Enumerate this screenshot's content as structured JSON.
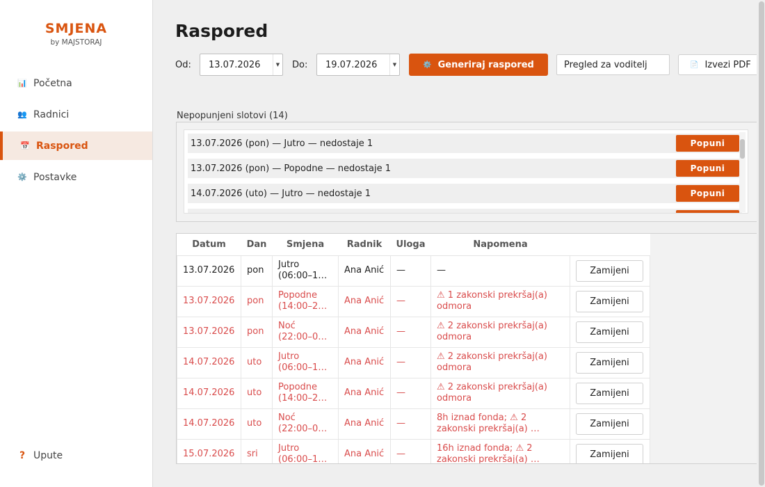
{
  "brand": {
    "name": "SMJENA",
    "sub": "by MAJSTORAJ"
  },
  "sidebar": {
    "items": [
      {
        "icon": "📊",
        "label": "Početna"
      },
      {
        "icon": "👥",
        "label": "Radnici"
      },
      {
        "icon": "📅",
        "label": "Raspored"
      },
      {
        "icon": "⚙️",
        "label": "Postavke"
      }
    ],
    "help": {
      "icon": "?",
      "label": "Upute"
    }
  },
  "page": {
    "title": "Raspored"
  },
  "toolbar": {
    "from_label": "Od:",
    "from_value": "13.07.2026",
    "to_label": "Do:",
    "to_value": "19.07.2026",
    "generate_label": "Generiraj raspored",
    "generate_icon": "⚙️",
    "view_label": "Pregled za voditelj",
    "pdf_label": "Izvezi PDF",
    "pdf_icon": "📄"
  },
  "unfilled": {
    "title": "Nepopunjeni slotovi (14)",
    "fill_label": "Popuni",
    "slots": [
      "13.07.2026 (pon) — Jutro — nedostaje 1",
      "13.07.2026 (pon) — Popodne — nedostaje 1",
      "14.07.2026 (uto) — Jutro — nedostaje 1",
      ""
    ]
  },
  "table": {
    "headers": [
      "Datum",
      "Dan",
      "Smjena",
      "Radnik",
      "Uloga",
      "Napomena",
      ""
    ],
    "swap_label": "Zamijeni",
    "rows": [
      {
        "datum": "13.07.2026",
        "dan": "pon",
        "smjena1": "Jutro",
        "smjena2": "(06:00–1…",
        "radnik": "Ana Anić",
        "uloga": "—",
        "nap1": "—",
        "nap2": ""
      },
      {
        "datum": "13.07.2026",
        "dan": "pon",
        "smjena1": "Popodne",
        "smjena2": "(14:00–2…",
        "radnik": "Ana Anić",
        "uloga": "—",
        "nap1": "⚠ 1 zakonski prekršaj(a)",
        "nap2": "odmora"
      },
      {
        "datum": "13.07.2026",
        "dan": "pon",
        "smjena1": "Noć",
        "smjena2": "(22:00–0…",
        "radnik": "Ana Anić",
        "uloga": "—",
        "nap1": "⚠ 2 zakonski prekršaj(a)",
        "nap2": "odmora"
      },
      {
        "datum": "14.07.2026",
        "dan": "uto",
        "smjena1": "Jutro",
        "smjena2": "(06:00–1…",
        "radnik": "Ana Anić",
        "uloga": "—",
        "nap1": "⚠ 2 zakonski prekršaj(a)",
        "nap2": "odmora"
      },
      {
        "datum": "14.07.2026",
        "dan": "uto",
        "smjena1": "Popodne",
        "smjena2": "(14:00–2…",
        "radnik": "Ana Anić",
        "uloga": "—",
        "nap1": "⚠ 2 zakonski prekršaj(a)",
        "nap2": "odmora"
      },
      {
        "datum": "14.07.2026",
        "dan": "uto",
        "smjena1": "Noć",
        "smjena2": "(22:00–0…",
        "radnik": "Ana Anić",
        "uloga": "—",
        "nap1": "8h iznad fonda; ⚠ 2",
        "nap2": "zakonski prekršaj(a) …"
      },
      {
        "datum": "15.07.2026",
        "dan": "sri",
        "smjena1": "Jutro",
        "smjena2": "(06:00–1…",
        "radnik": "Ana Anić",
        "uloga": "—",
        "nap1": "16h iznad fonda; ⚠ 2",
        "nap2": "zakonski prekršaj(a) …"
      }
    ]
  },
  "colors": {
    "accent": "#d9540f",
    "warning_text": "#d94b4b",
    "active_bg": "#f6e9e1"
  }
}
